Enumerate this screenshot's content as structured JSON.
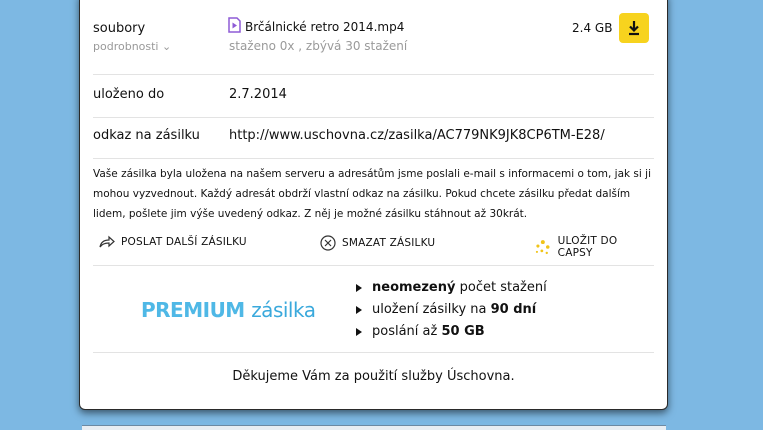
{
  "files": {
    "label": "soubory",
    "details_link": "podrobnosti",
    "file_name": "Brčálnické retro 2014.mp4",
    "status": "staženo 0x , zbývá 30 stažení",
    "size": "2.4 GB"
  },
  "stored_until": {
    "label": "uloženo do",
    "value": "2.7.2014"
  },
  "link": {
    "label": "odkaz na zásilku",
    "value": "http://www.uschovna.cz/zasilka/AC779NK9JK8CP6TM-E28/"
  },
  "info_text": "Vaše zásilka byla uložena na našem serveru a adresátům jsme poslali e-mail s informacemi o tom, jak si ji mohou vyzvednout. Každý adresát obdrží vlastní odkaz na zásilku. Pokud chcete zásilku předat dalším lidem, pošlete jim výše uvedený odkaz. Z něj je možné zásilku stáhnout až 30krát.",
  "actions": {
    "send_another": "POSLAT DALŠÍ ZÁSILKU",
    "delete": "SMAZAT ZÁSILKU",
    "save_capsy": "ULOŽIT DO CAPSY"
  },
  "premium": {
    "logo_main": "PREMIUM",
    "logo_sub": "zásilka",
    "f1_bold": "neomezený",
    "f1_rest": " počet stažení",
    "f2_text": "uložení zásilky na ",
    "f2_bold": "90 dní",
    "f3_text": "poslání až ",
    "f3_bold": "50 GB"
  },
  "thanks": "Děkujeme Vám za použití služby Úschovna.",
  "colors": {
    "background": "#7db8e3",
    "download_button": "#f7d31e",
    "file_icon": "#8e5bd6",
    "premium": "#4fb8e6"
  }
}
